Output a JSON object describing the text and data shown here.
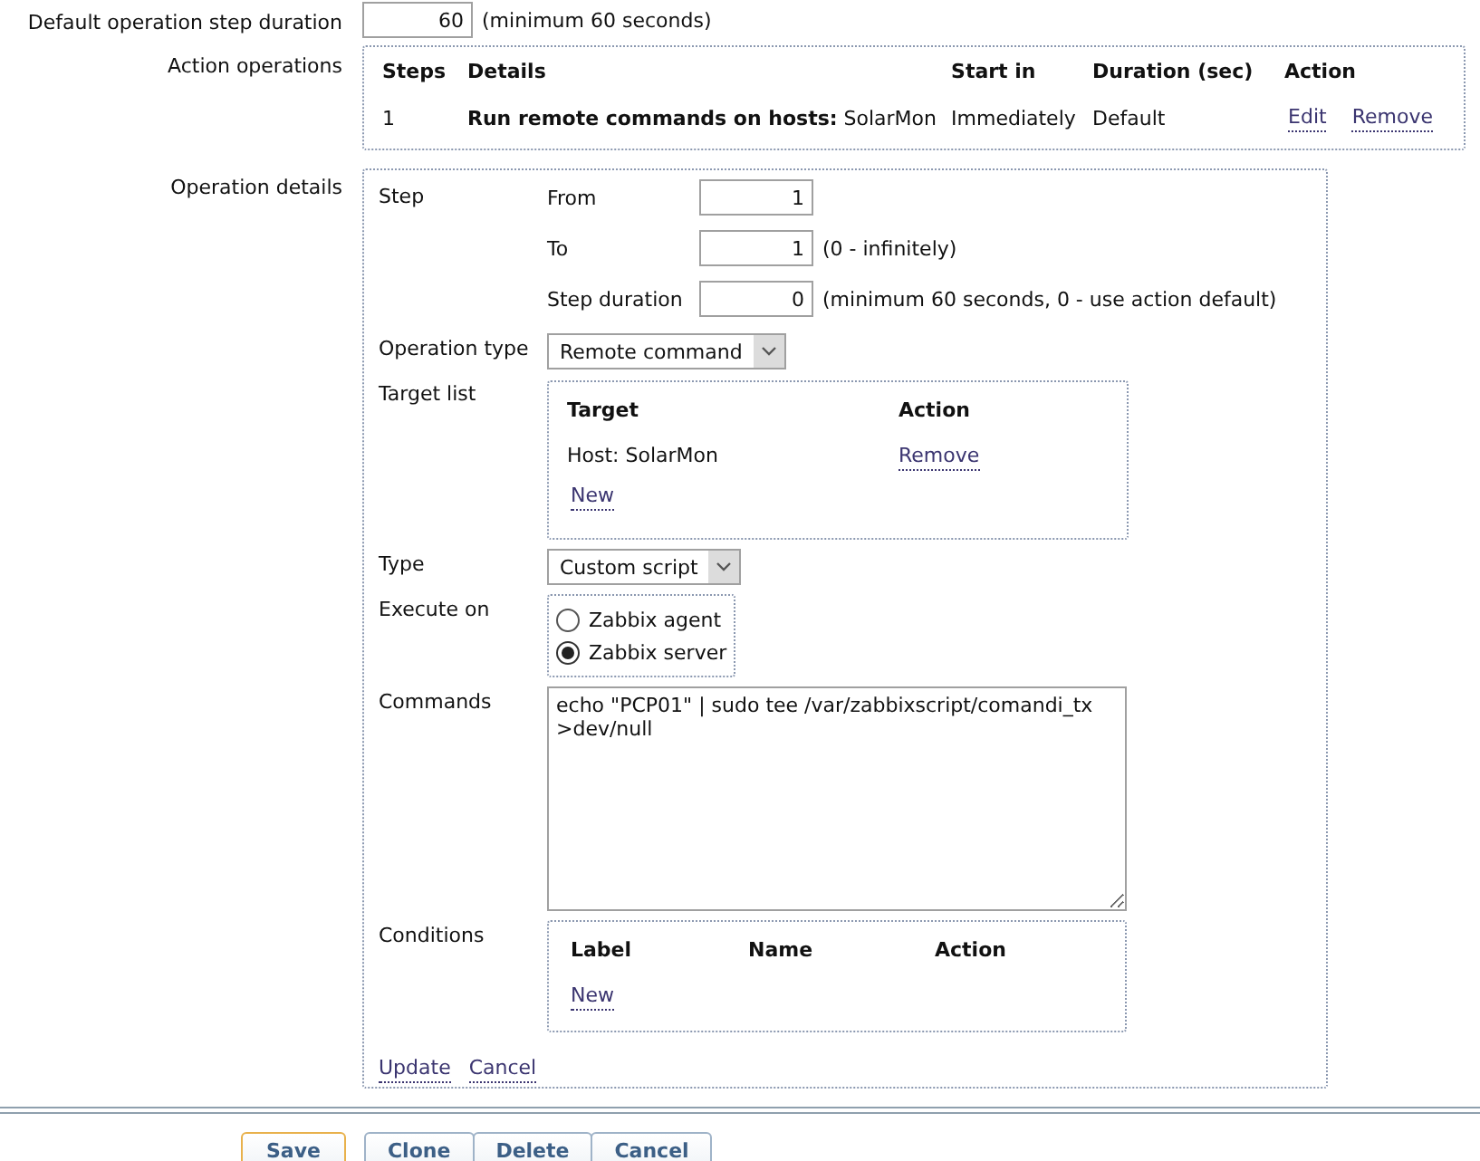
{
  "default_step_duration": {
    "label": "Default operation step duration",
    "value": "60",
    "hint": "(minimum 60 seconds)"
  },
  "action_operations": {
    "label": "Action operations",
    "columns": [
      "Steps",
      "Details",
      "Start in",
      "Duration (sec)",
      "Action"
    ],
    "rows": [
      {
        "steps": "1",
        "details": "**Run remote commands on hosts:** SolarMon",
        "start_in": "Immediately",
        "duration": "Default",
        "links": [
          "Edit",
          "Remove"
        ]
      }
    ]
  },
  "operation_details": {
    "label": "Operation details",
    "step": {
      "label": "Step",
      "fields": [
        {
          "label": "From",
          "value": "1"
        },
        {
          "label": "To",
          "value": "1",
          "hint": "(0 - infinitely)"
        },
        {
          "label": "Step duration",
          "value": "0",
          "hint": "(minimum 60 seconds, 0 - use action default)"
        }
      ]
    },
    "operation_type": {
      "label": "Operation type",
      "value": "Remote command"
    },
    "target_list": {
      "label": "Target list",
      "columns": [
        "Target",
        "Action"
      ],
      "rows": [
        {
          "target": "Host: SolarMon",
          "action": "Remove"
        }
      ],
      "new_link": "New"
    },
    "type": {
      "label": "Type",
      "value": "Custom script"
    },
    "execute_on": {
      "label": "Execute on",
      "options": [
        {
          "label": "Zabbix agent",
          "selected": false
        },
        {
          "label": "Zabbix server",
          "selected": true
        }
      ]
    },
    "commands": {
      "label": "Commands",
      "value": "echo \"PCP01\" | sudo tee /var/zabbixscript/comandi_tx >dev/null"
    },
    "conditions": {
      "label": "Conditions",
      "columns": [
        "Label",
        "Name",
        "Action"
      ],
      "new_link": "New"
    },
    "links": [
      "Update",
      "Cancel"
    ]
  },
  "buttons": [
    {
      "label": "Save",
      "primary": true
    },
    {
      "label": "Clone",
      "primary": false
    },
    {
      "label": "Delete",
      "primary": false
    },
    {
      "label": "Cancel",
      "primary": false
    }
  ]
}
